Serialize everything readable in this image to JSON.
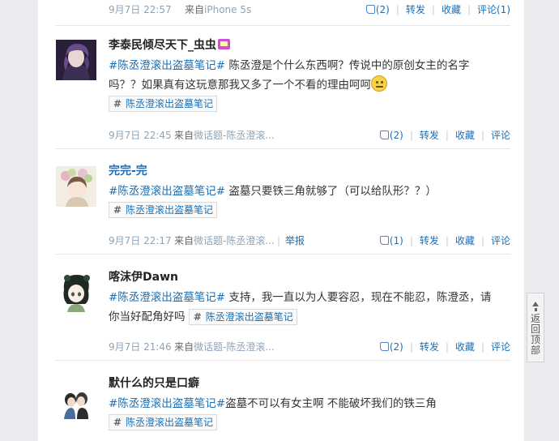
{
  "top_meta": {
    "time": "9月7日 22:57",
    "from_prefix": "来自",
    "source": "iPhone 5s",
    "like_count": "(2)",
    "repost": "转发",
    "favorite": "收藏",
    "comment": "评论(1)"
  },
  "posts": [
    {
      "username": "李泰民倾尽天下_虫虫",
      "topic": "#陈丞澄滚出盗墓笔记#",
      "text_line1": " 陈丞澄是个什么东西啊？传说中的原创女主的名字",
      "text_line2": "吗？？如果真有这玩意那我又多了一个不看的理由呵呵",
      "tag": "陈丞澄滚出盗墓笔记",
      "time": "9月7日 22:45",
      "from_prefix": "来自",
      "source": "微话题-陈丞澄滚...",
      "like_count": "(2)",
      "repost": "转发",
      "favorite": "收藏",
      "comment": "评论"
    },
    {
      "username": "完完-完",
      "topic": "#陈丞澄滚出盗墓笔记#",
      "text_line1": " 盗墓只要铁三角就够了（可以给队形？？）",
      "tag": "陈丞澄滚出盗墓笔记",
      "time": "9月7日 22:17",
      "from_prefix": "来自",
      "source": "微话题-陈丞澄滚...",
      "report": "举报",
      "like_count": "(1)",
      "repost": "转发",
      "favorite": "收藏",
      "comment": "评论"
    },
    {
      "username": "喀沫伊Dawn",
      "topic": "#陈丞澄滚出盗墓笔记#",
      "text_line1": " 支持，我一直以为人要容忍，现在不能忍，陈澄丞，请",
      "text_line2": "你当好配角好吗",
      "tag": "陈丞澄滚出盗墓笔记",
      "time": "9月7日 21:46",
      "from_prefix": "来自",
      "source": "微话题-陈丞澄滚...",
      "like_count": "(2)",
      "repost": "转发",
      "favorite": "收藏",
      "comment": "评论"
    },
    {
      "username": "默什么的只是口癖",
      "topic": "#陈丞澄滚出盗墓笔记#",
      "text_line1": "盗墓不可以有女主啊 不能破坏我们的铁三角",
      "tag": "陈丞澄滚出盗墓笔记"
    }
  ],
  "scroll_top": {
    "label": "返回顶部"
  },
  "colors": {
    "link": "#1a6fb5",
    "meta": "#8ea3b8"
  }
}
